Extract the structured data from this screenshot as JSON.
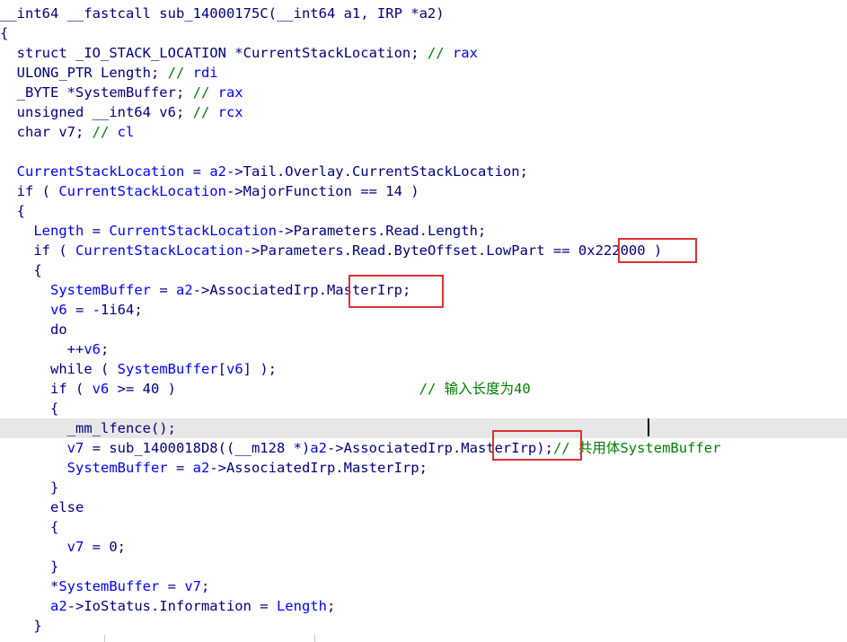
{
  "code": {
    "lines": [
      "__int64 __fastcall sub_14000175C(__int64 a1, IRP *a2)",
      "{",
      "  struct _IO_STACK_LOCATION *CurrentStackLocation; // rax",
      "  ULONG_PTR Length; // rdi",
      "  _BYTE *SystemBuffer; // rax",
      "  unsigned __int64 v6; // rcx",
      "  char v7; // cl",
      "",
      "  CurrentStackLocation = a2->Tail.Overlay.CurrentStackLocation;",
      "  if ( CurrentStackLocation->MajorFunction == 14 )",
      "  {",
      "    Length = CurrentStackLocation->Parameters.Read.Length;",
      "    if ( CurrentStackLocation->Parameters.Read.ByteOffset.LowPart == 0x222000 )",
      "    {",
      "      SystemBuffer = a2->AssociatedIrp.MasterIrp;",
      "      v6 = -1i64;",
      "      do",
      "        ++v6;",
      "      while ( SystemBuffer[v6] );",
      "      if ( v6 >= 40 )                             // 输入长度为40",
      "      {",
      "        _mm_lfence();",
      "        v7 = sub_1400018D8((__m128 *)a2->AssociatedIrp.MasterIrp);// 共用体SystemBuffer",
      "        SystemBuffer = a2->AssociatedIrp.MasterIrp;",
      "      }",
      "      else",
      "      {",
      "        v7 = 0;",
      "      }",
      "      *SystemBuffer = v7;",
      "      a2->IoStatus.Information = Length;",
      "    }"
    ]
  },
  "highlighted_line_index": 21,
  "colors": {
    "identifier": "#000080",
    "local_variable": "#0000ff",
    "comment": "#008000",
    "highlight_box": "#e03030",
    "current_line": "#e7e7e7"
  }
}
